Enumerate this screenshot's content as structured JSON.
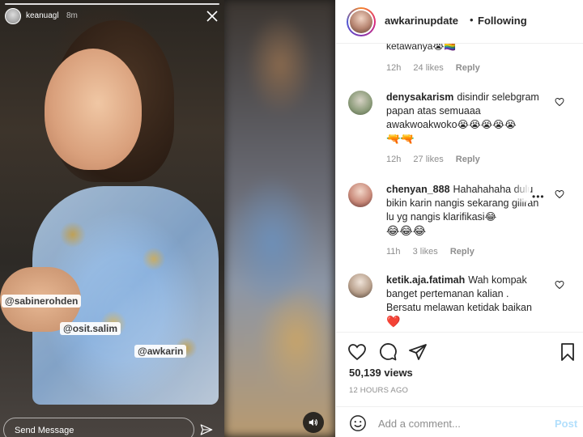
{
  "story": {
    "username": "keanuagl",
    "time": "8m",
    "mentions": [
      "@sabinerohden",
      "@osit.salim",
      "@awkarin"
    ],
    "send_placeholder": "Send Message"
  },
  "post": {
    "username": "awkarinupdate",
    "dot": "•",
    "following": "Following"
  },
  "comments": {
    "partial": {
      "text_fragment": "ketawanya",
      "emojis": "😭🏳️‍🌈",
      "time": "12h",
      "likes": "24 likes",
      "reply": "Reply"
    },
    "items": [
      {
        "user": "denysakarism",
        "text": "disindir selebgram papan atas semuaaa awakwoakwoko😭😭😭😭😭",
        "emojis": "🔫🔫",
        "time": "12h",
        "likes": "27 likes",
        "reply": "Reply"
      },
      {
        "user": "chenyan_888",
        "text": "Hahahahaha dulu bikin karin nangis sekarang giliran lu yg nangis klarifikasi😂",
        "emojis": "😂😂😂",
        "time": "11h",
        "likes": "3 likes",
        "reply": "Reply",
        "more": "•••"
      },
      {
        "user": "ketik.aja.fatimah",
        "text": "Wah kompak banget pertemanan kalian . Bersatu melawan ketidak baikan",
        "emojis": "❤️",
        "time": "",
        "likes": "",
        "reply": ""
      }
    ]
  },
  "stats": {
    "views": "50,139 views",
    "ago": "12 HOURS AGO"
  },
  "comment_box": {
    "placeholder": "Add a comment...",
    "post_label": "Post"
  },
  "icons": {
    "story_close": "close-icon",
    "story_send": "send-icon",
    "audio": "speaker-icon",
    "like": "heart-icon",
    "comment": "comment-icon",
    "share": "paper-plane-icon",
    "save": "bookmark-icon",
    "emoji": "smile-icon"
  },
  "colors": {
    "muted": "#8e8e8e",
    "post_disabled": "#b2dffc",
    "border": "#efefef",
    "heart_red": "#ed4956"
  }
}
